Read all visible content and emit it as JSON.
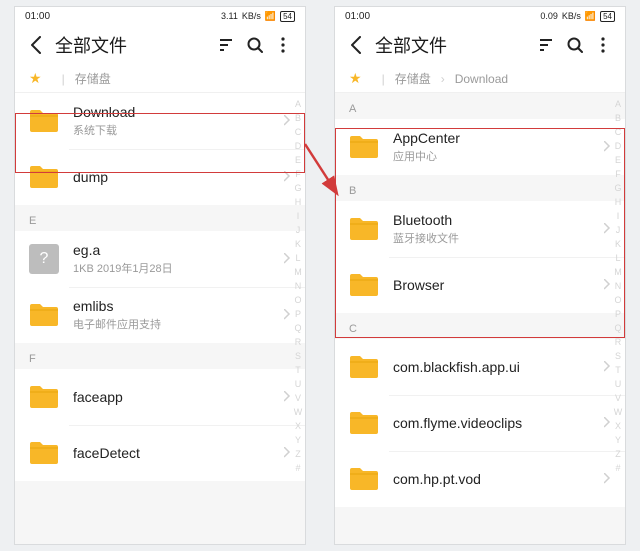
{
  "statusbar": {
    "time": "01:00",
    "net": "3.11",
    "netUnit": "KB/s",
    "net2": "0.09",
    "batt": "54"
  },
  "title": "全部文件",
  "crumb": {
    "root": "存储盘",
    "child": "Download"
  },
  "alpha": [
    "A",
    "B",
    "C",
    "D",
    "E",
    "F",
    "G",
    "H",
    "I",
    "J",
    "K",
    "L",
    "M",
    "N",
    "O",
    "P",
    "Q",
    "R",
    "S",
    "T",
    "U",
    "V",
    "W",
    "X",
    "Y",
    "Z",
    "#"
  ],
  "left": {
    "items": [
      {
        "kind": "folder",
        "name": "Download",
        "sub": "系统下载",
        "hl": true
      },
      {
        "kind": "folder",
        "name": "dump",
        "sub": ""
      },
      {
        "kind": "section",
        "letter": "E"
      },
      {
        "kind": "file",
        "name": "eg.a",
        "sub": "1KB  2019年1月28日"
      },
      {
        "kind": "folder",
        "name": "emlibs",
        "sub": "电子邮件应用支持"
      },
      {
        "kind": "section",
        "letter": "F"
      },
      {
        "kind": "folder",
        "name": "faceapp",
        "sub": ""
      },
      {
        "kind": "folder",
        "name": "faceDetect",
        "sub": ""
      }
    ]
  },
  "right": {
    "items": [
      {
        "kind": "section",
        "letter": "A"
      },
      {
        "kind": "folder",
        "name": "AppCenter",
        "sub": "应用中心"
      },
      {
        "kind": "section",
        "letter": "B"
      },
      {
        "kind": "folder",
        "name": "Bluetooth",
        "sub": "蓝牙接收文件"
      },
      {
        "kind": "folder",
        "name": "Browser",
        "sub": ""
      },
      {
        "kind": "section",
        "letter": "C"
      },
      {
        "kind": "folder",
        "name": "com.blackfish.app.ui",
        "sub": ""
      },
      {
        "kind": "folder",
        "name": "com.flyme.videoclips",
        "sub": ""
      },
      {
        "kind": "folder",
        "name": "com.hp.pt.vod",
        "sub": ""
      }
    ]
  }
}
